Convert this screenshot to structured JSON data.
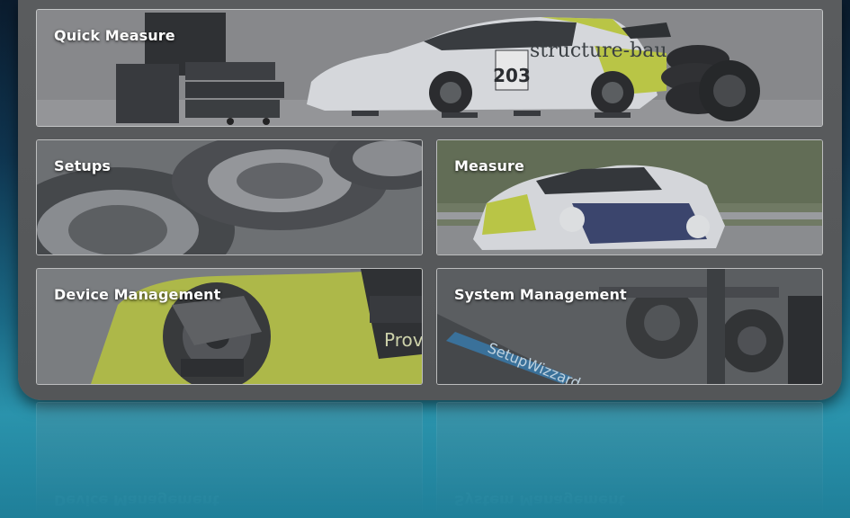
{
  "menu": {
    "quick_measure": "Quick Measure",
    "setups": "Setups",
    "measure": "Measure",
    "device_management": "Device Management",
    "system_management": "System Management"
  },
  "car_number": "203",
  "car_sponsor_text": "structure-bau",
  "setups_tire_text": "Prov",
  "system_brand_text": "SetupWizzard",
  "colors": {
    "panel": "#57595b",
    "accent_lime": "#c7d63a",
    "background_top": "#0b1c2e",
    "background_bottom": "#2a93ac"
  }
}
